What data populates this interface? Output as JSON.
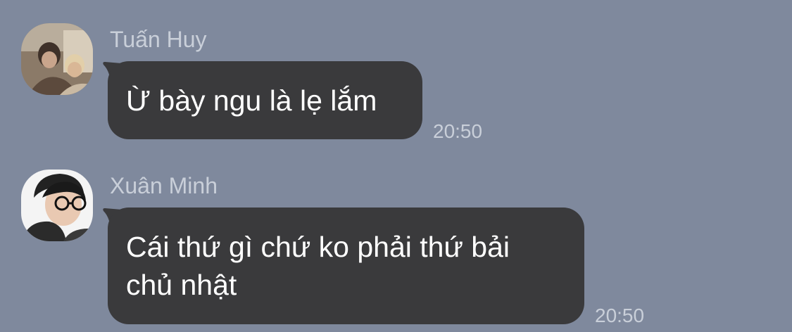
{
  "chat": {
    "messages": [
      {
        "sender": "Tuấn Huy",
        "text_lines": [
          "Ừ bày ngu là lẹ lắm"
        ],
        "time": "20:50",
        "avatar": "profile-photo"
      },
      {
        "sender": "Xuân Minh",
        "text_lines": [
          "Cái thứ gì chứ ko phải thứ bải",
          "chủ nhật"
        ],
        "time": "20:50",
        "avatar": "profile-photo"
      }
    ]
  },
  "colors": {
    "background": "#7f899d",
    "bubble": "#3a3a3c",
    "bubble_text": "#ffffff",
    "meta_text": "#c9cfd9"
  }
}
